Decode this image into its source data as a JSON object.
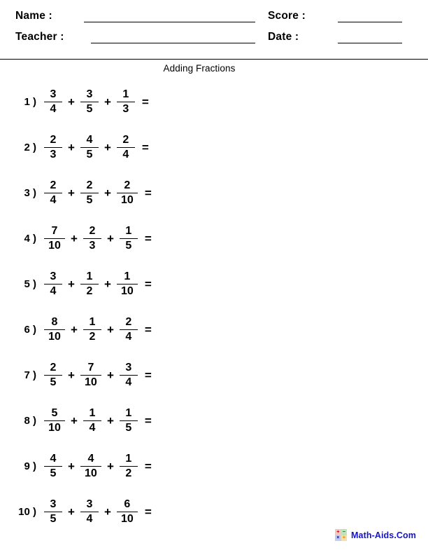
{
  "header": {
    "name_label": "Name :",
    "teacher_label": "Teacher :",
    "score_label": "Score :",
    "date_label": "Date :",
    "name_value": "",
    "teacher_value": "",
    "score_value": "",
    "date_value": ""
  },
  "title": "Adding Fractions",
  "problems": [
    {
      "number": "1 )",
      "terms": [
        {
          "n": "3",
          "d": "4"
        },
        {
          "n": "3",
          "d": "5"
        },
        {
          "n": "1",
          "d": "3"
        }
      ],
      "operator": "+",
      "equals": "="
    },
    {
      "number": "2 )",
      "terms": [
        {
          "n": "2",
          "d": "3"
        },
        {
          "n": "4",
          "d": "5"
        },
        {
          "n": "2",
          "d": "4"
        }
      ],
      "operator": "+",
      "equals": "="
    },
    {
      "number": "3 )",
      "terms": [
        {
          "n": "2",
          "d": "4"
        },
        {
          "n": "2",
          "d": "5"
        },
        {
          "n": "2",
          "d": "10"
        }
      ],
      "operator": "+",
      "equals": "="
    },
    {
      "number": "4 )",
      "terms": [
        {
          "n": "7",
          "d": "10"
        },
        {
          "n": "2",
          "d": "3"
        },
        {
          "n": "1",
          "d": "5"
        }
      ],
      "operator": "+",
      "equals": "="
    },
    {
      "number": "5 )",
      "terms": [
        {
          "n": "3",
          "d": "4"
        },
        {
          "n": "1",
          "d": "2"
        },
        {
          "n": "1",
          "d": "10"
        }
      ],
      "operator": "+",
      "equals": "="
    },
    {
      "number": "6 )",
      "terms": [
        {
          "n": "8",
          "d": "10"
        },
        {
          "n": "1",
          "d": "2"
        },
        {
          "n": "2",
          "d": "4"
        }
      ],
      "operator": "+",
      "equals": "="
    },
    {
      "number": "7 )",
      "terms": [
        {
          "n": "2",
          "d": "5"
        },
        {
          "n": "7",
          "d": "10"
        },
        {
          "n": "3",
          "d": "4"
        }
      ],
      "operator": "+",
      "equals": "="
    },
    {
      "number": "8 )",
      "terms": [
        {
          "n": "5",
          "d": "10"
        },
        {
          "n": "1",
          "d": "4"
        },
        {
          "n": "1",
          "d": "5"
        }
      ],
      "operator": "+",
      "equals": "="
    },
    {
      "number": "9 )",
      "terms": [
        {
          "n": "4",
          "d": "5"
        },
        {
          "n": "4",
          "d": "10"
        },
        {
          "n": "1",
          "d": "2"
        }
      ],
      "operator": "+",
      "equals": "="
    },
    {
      "number": "10 )",
      "terms": [
        {
          "n": "3",
          "d": "5"
        },
        {
          "n": "3",
          "d": "4"
        },
        {
          "n": "6",
          "d": "10"
        }
      ],
      "operator": "+",
      "equals": "="
    }
  ],
  "footer": {
    "brand": "Math-Aids.Com",
    "logo": {
      "plus": "+",
      "minus": "−",
      "times": "×",
      "divide": "÷",
      "plus_color": "#cc0000",
      "minus_color": "#006600",
      "times_color": "#0000aa",
      "divide_color": "#cc7a00"
    },
    "brand_color": "#1414cc"
  }
}
